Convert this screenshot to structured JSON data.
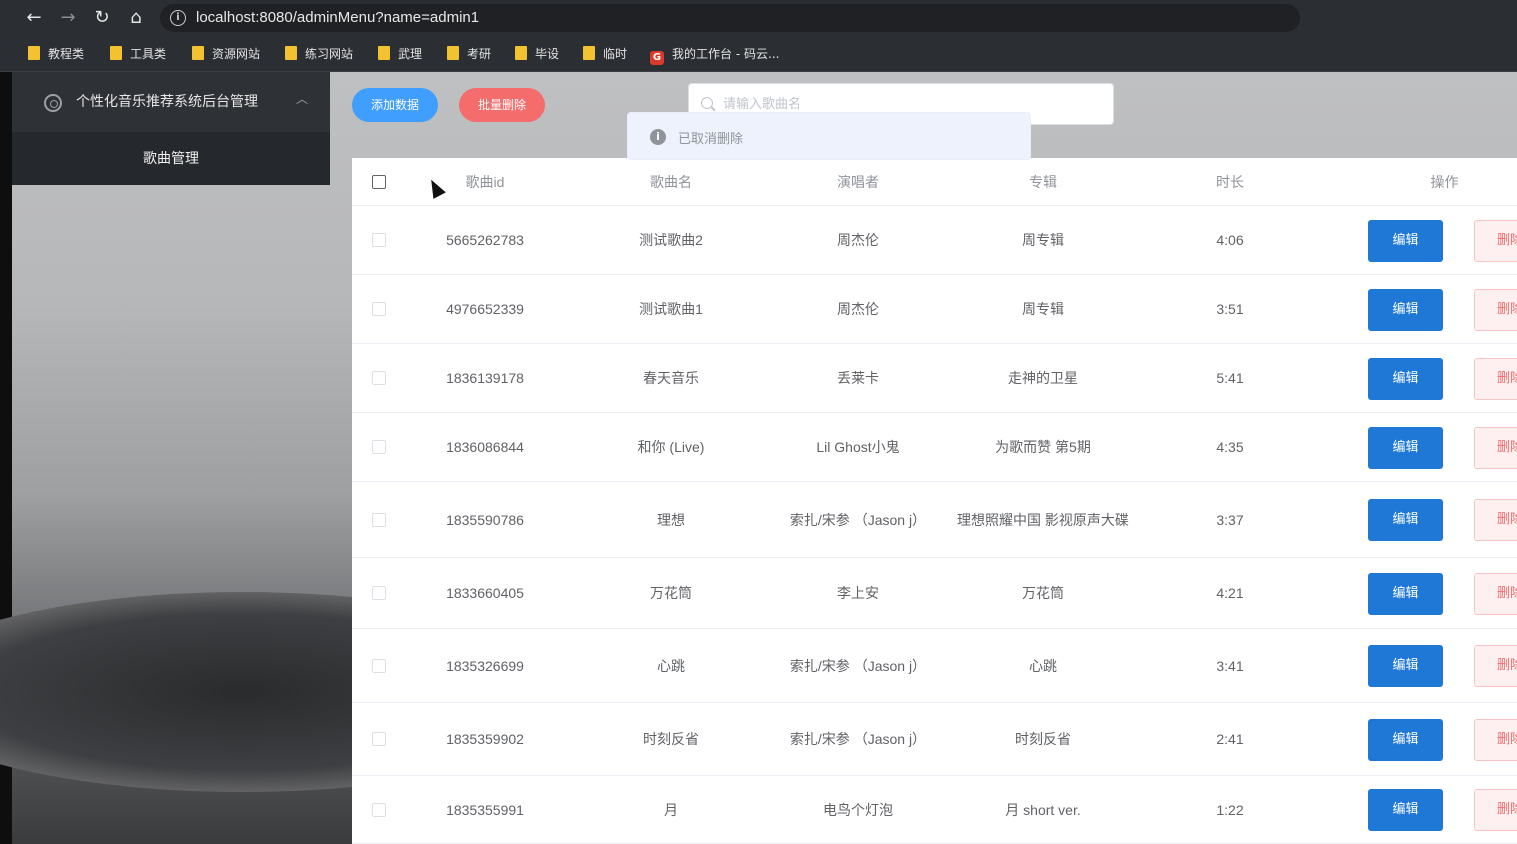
{
  "browser": {
    "url": "localhost:8080/adminMenu?name=admin1",
    "back": "←",
    "forward": "→",
    "reload": "↻",
    "home": "⌂",
    "bookmarks": [
      {
        "label": "教程类",
        "icon": "folder-icon"
      },
      {
        "label": "工具类",
        "icon": "folder-icon"
      },
      {
        "label": "资源网站",
        "icon": "folder-icon"
      },
      {
        "label": "练习网站",
        "icon": "folder-icon"
      },
      {
        "label": "武理",
        "icon": "folder-icon"
      },
      {
        "label": "考研",
        "icon": "folder-icon"
      },
      {
        "label": "毕设",
        "icon": "folder-icon"
      },
      {
        "label": "临时",
        "icon": "folder-icon"
      },
      {
        "label": "我的工作台 - 码云...",
        "icon": "gitee-icon"
      }
    ]
  },
  "sidebar": {
    "title": "个性化音乐推荐系统后台管理",
    "items": [
      {
        "label": "歌曲管理"
      }
    ]
  },
  "toolbar": {
    "add_label": "添加数据",
    "batch_delete_label": "批量删除",
    "search_placeholder": "请输入歌曲名"
  },
  "toast": {
    "text": "已取消删除"
  },
  "table": {
    "headers": {
      "id": "歌曲id",
      "name": "歌曲名",
      "singer": "演唱者",
      "album": "专辑",
      "duration": "时长",
      "ops": "操作"
    },
    "edit_label": "编辑",
    "delete_label": "删除",
    "rows": [
      {
        "id": "5665262783",
        "name": "测试歌曲2",
        "singer": "周杰伦",
        "album": "周专辑",
        "duration": "4:06"
      },
      {
        "id": "4976652339",
        "name": "测试歌曲1",
        "singer": "周杰伦",
        "album": "周专辑",
        "duration": "3:51"
      },
      {
        "id": "1836139178",
        "name": "春天音乐",
        "singer": "丢莱卡",
        "album": "走神的卫星",
        "duration": "5:41"
      },
      {
        "id": "1836086844",
        "name": "和你 (Live)",
        "singer": "Lil Ghost小鬼",
        "album": "为歌而赞 第5期",
        "duration": "4:35"
      },
      {
        "id": "1835590786",
        "name": "理想",
        "singer": "索扎/宋参 （Jason j）",
        "album": "理想照耀中国 影视原声大碟",
        "duration": "3:37"
      },
      {
        "id": "1833660405",
        "name": "万花筒",
        "singer": "李上安",
        "album": "万花筒",
        "duration": "4:21"
      },
      {
        "id": "1835326699",
        "name": "心跳",
        "singer": "索扎/宋参 （Jason j）",
        "album": "心跳",
        "duration": "3:41"
      },
      {
        "id": "1835359902",
        "name": "时刻反省",
        "singer": "索扎/宋参 （Jason j）",
        "album": "时刻反省",
        "duration": "2:41"
      },
      {
        "id": "1835355991",
        "name": "月",
        "singer": "电鸟个灯泡",
        "album": "月 short ver.",
        "duration": "1:22"
      }
    ]
  }
}
